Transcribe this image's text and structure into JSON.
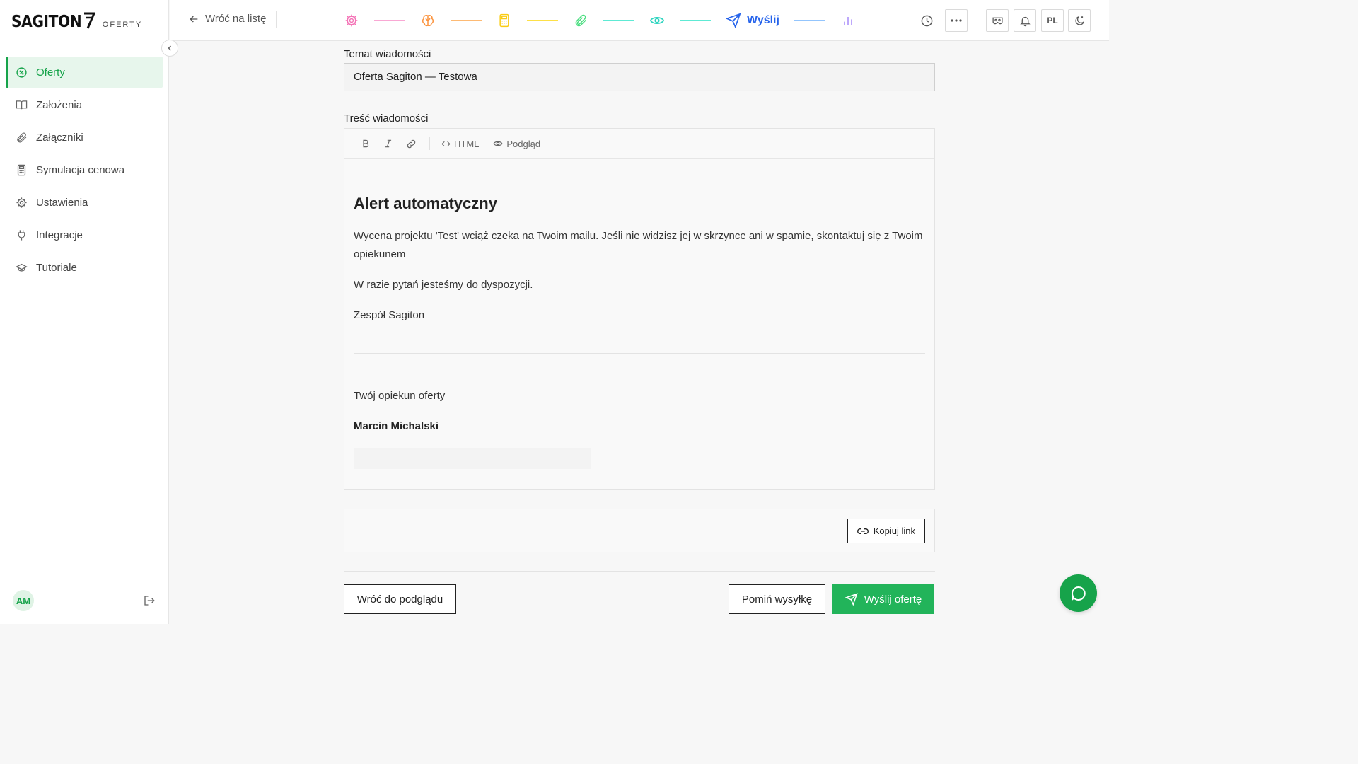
{
  "brand": {
    "name": "SAGITON",
    "product": "OFERTY",
    "accent": "#16a34a"
  },
  "sidebar": {
    "items": [
      {
        "label": "Oferty",
        "icon": "offer-badge-icon",
        "active": true
      },
      {
        "label": "Założenia",
        "icon": "book-icon",
        "active": false
      },
      {
        "label": "Załączniki",
        "icon": "paperclip-icon",
        "active": false
      },
      {
        "label": "Symulacja cenowa",
        "icon": "calculator-icon",
        "active": false
      },
      {
        "label": "Ustawienia",
        "icon": "gear-icon",
        "active": false
      },
      {
        "label": "Integracje",
        "icon": "plug-icon",
        "active": false
      },
      {
        "label": "Tutoriale",
        "icon": "graduation-cap-icon",
        "active": false
      }
    ],
    "user_initials": "AM"
  },
  "topbar": {
    "back_label": "Wróć na listę",
    "current_step_label": "Wyślij",
    "language": "PL",
    "steps": [
      {
        "icon": "gear-icon",
        "color": "#f472b6"
      },
      {
        "icon": "brain-icon",
        "color": "#fb923c"
      },
      {
        "icon": "calculator-icon",
        "color": "#facc15"
      },
      {
        "icon": "paperclip-icon",
        "color": "#4ade80"
      },
      {
        "icon": "eye-icon",
        "color": "#2dd4bf"
      },
      {
        "icon": "send-icon",
        "color": "#2563eb"
      },
      {
        "icon": "bar-chart-icon",
        "color": "#a78bfa"
      }
    ]
  },
  "form": {
    "subject_label": "Temat wiadomości",
    "subject_value": "Oferta Sagiton — Testowa",
    "body_label": "Treść wiadomości",
    "toolbar": {
      "html_label": "HTML",
      "preview_label": "Podgląd"
    },
    "body": {
      "heading": "Alert automatyczny",
      "paragraph1": "Wycena projektu 'Test' wciąż czeka na Twoim mailu. Jeśli nie widzisz jej w skrzynce ani w spamie, skontaktuj się z Twoim opiekunem",
      "paragraph2": "W razie pytań jesteśmy do dyspozycji.",
      "paragraph3": "Zespół Sagiton",
      "signature_intro": "Twój opiekun oferty",
      "signature_name": "Marcin Michalski"
    },
    "copy_link_label": "Kopiuj link"
  },
  "actions": {
    "back_to_preview": "Wróć do podglądu",
    "skip_send": "Pomiń wysyłkę",
    "send_offer": "Wyślij ofertę"
  }
}
